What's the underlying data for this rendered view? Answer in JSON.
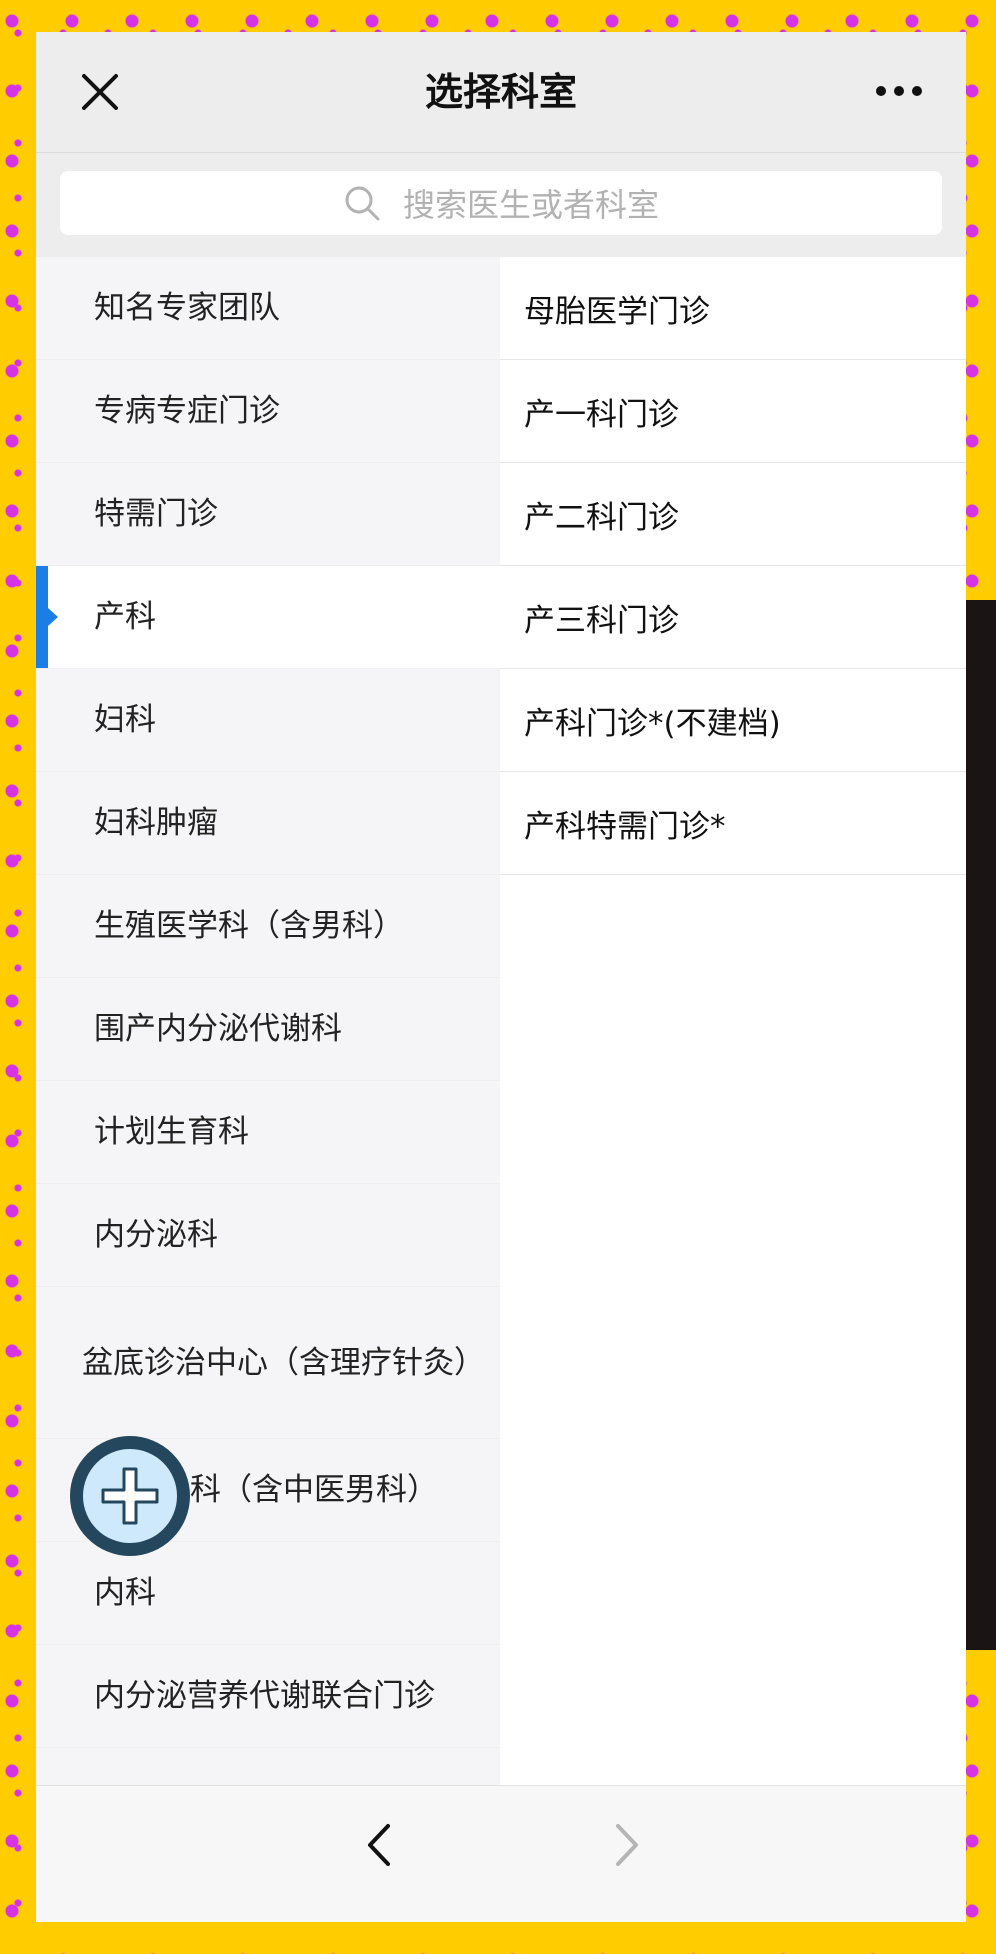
{
  "header": {
    "title": "选择科室"
  },
  "search": {
    "placeholder": "搜索医生或者科室"
  },
  "departments": [
    {
      "label": "知名专家团队"
    },
    {
      "label": "专病专症门诊"
    },
    {
      "label": "特需门诊"
    },
    {
      "label": "产科",
      "active": true
    },
    {
      "label": "妇科"
    },
    {
      "label": "妇科肿瘤"
    },
    {
      "label": "生殖医学科（含男科）"
    },
    {
      "label": "围产内分泌代谢科"
    },
    {
      "label": "计划生育科"
    },
    {
      "label": "内分泌科"
    },
    {
      "label": "盆底诊治中心（含理疗针灸）"
    },
    {
      "label": "科（含中医男科）"
    },
    {
      "label": "内科"
    },
    {
      "label": "内分泌营养代谢联合门诊"
    }
  ],
  "clinics": [
    {
      "label": "母胎医学门诊"
    },
    {
      "label": "产一科门诊"
    },
    {
      "label": "产二科门诊"
    },
    {
      "label": "产三科门诊"
    },
    {
      "label": "产科门诊*(不建档)"
    },
    {
      "label": "产科特需门诊*"
    }
  ],
  "icons": {
    "close": "close-icon",
    "more": "more-dots-icon",
    "search": "search-icon",
    "fab": "plus-icon",
    "back": "chevron-left-icon",
    "forward": "chevron-right-icon"
  },
  "colors": {
    "accent": "#1b7ee6",
    "background": "#ffcc00",
    "fab_ring": "#24475e",
    "fab_fill": "#cde9fb"
  }
}
